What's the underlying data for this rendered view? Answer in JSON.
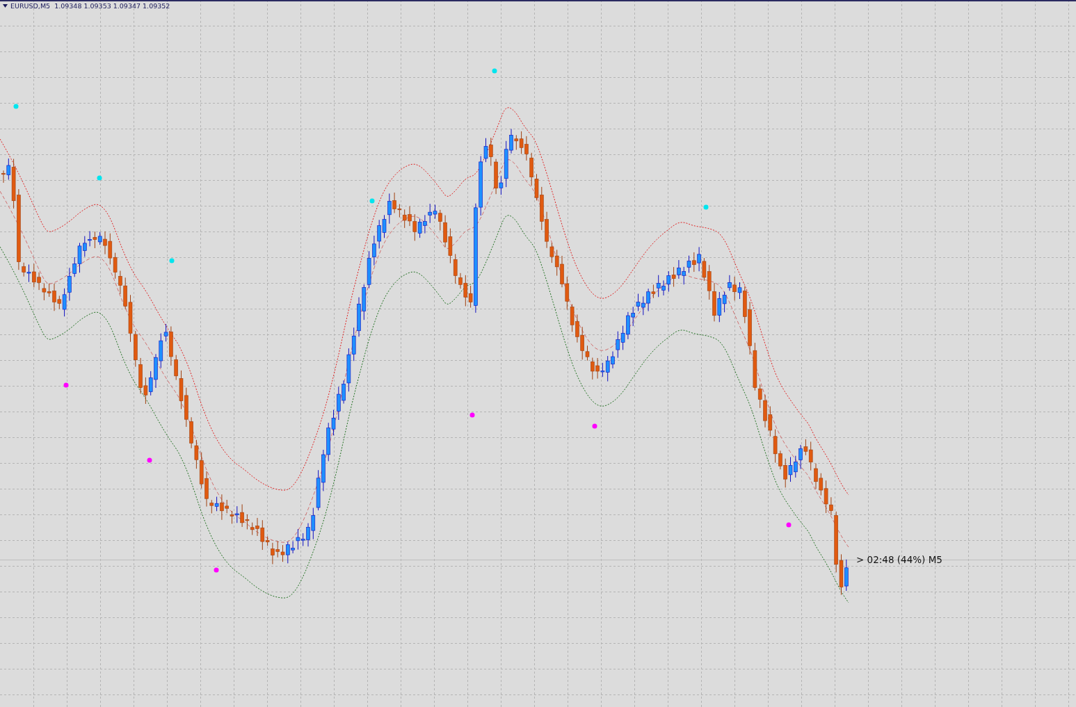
{
  "chart_header": {
    "text": "EURUSD,M5  1.09348 1.09353 1.09347 1.09352"
  },
  "countdown_label": {
    "text": "> 02:48 (44%) M5"
  }
}
